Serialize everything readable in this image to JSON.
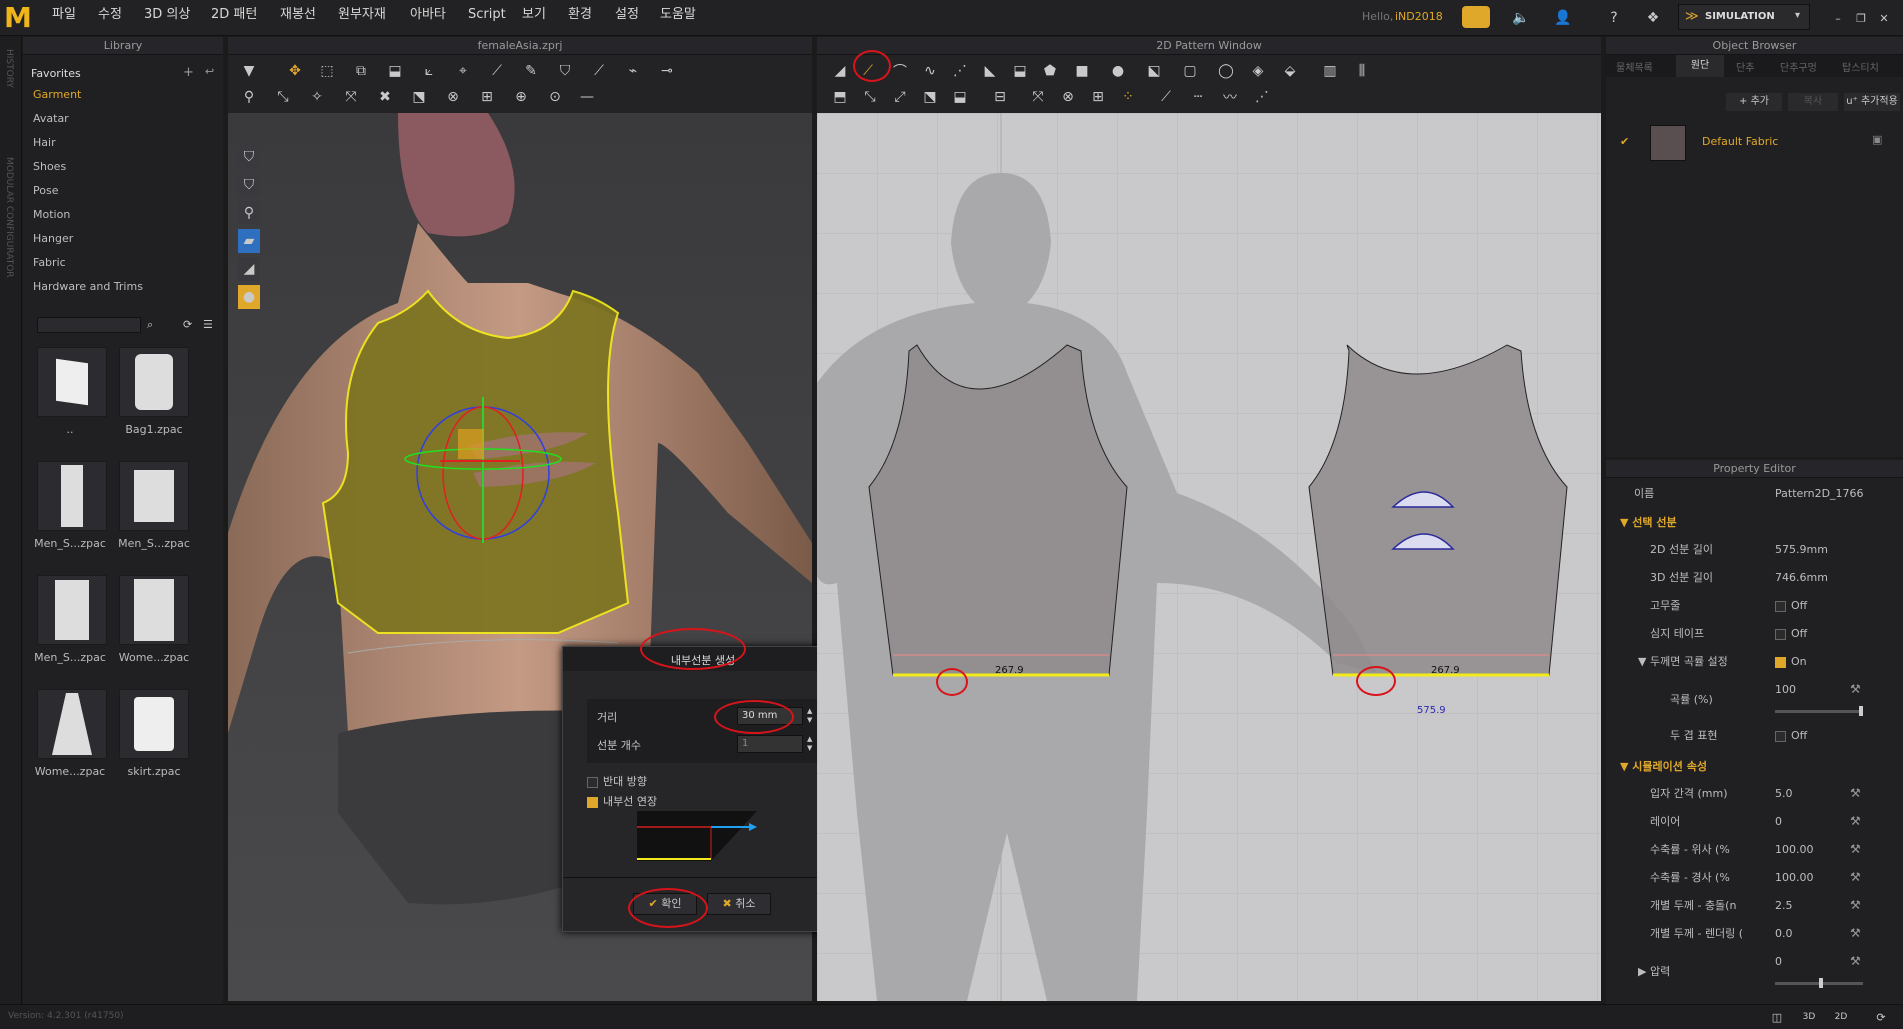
{
  "app": {
    "logo": "M",
    "greeting": "Hello,",
    "user": "iND2018",
    "simulation_label": "SIMULATION",
    "version": "Version: 4.2.301 (r41750)"
  },
  "menu": [
    "파일",
    "수정",
    "3D 의상",
    "2D 패턴",
    "재봉선",
    "원부자재",
    "아바타",
    "Script",
    "보기",
    "환경",
    "설정",
    "도움말"
  ],
  "left_strip": {
    "history": "HISTORY",
    "modular": "MODULAR CONFIGURATOR"
  },
  "library": {
    "title": "Library",
    "favorites": "Favorites",
    "items": [
      "Garment",
      "Avatar",
      "Hair",
      "Shoes",
      "Pose",
      "Motion",
      "Hanger",
      "Fabric",
      "Hardware and Trims"
    ],
    "search_placeholder": "",
    "thumbs": [
      {
        "label": ".."
      },
      {
        "label": "Bag1.zpac"
      },
      {
        "label": "Men_S...zpac"
      },
      {
        "label": "Men_S...zpac"
      },
      {
        "label": "Men_S...zpac"
      },
      {
        "label": "Wome...zpac"
      },
      {
        "label": "Wome...zpac"
      },
      {
        "label": "skirt.zpac"
      }
    ]
  },
  "window3d": {
    "title": "femaleAsia.zprj"
  },
  "window2d": {
    "title": "2D Pattern Window",
    "front_measure": "267.9",
    "back_measure": "267.9",
    "back_total": "575.9"
  },
  "dialog": {
    "title": "내부선분 생성",
    "distance_label": "거리",
    "distance_value": "30 mm",
    "count_label": "선분 개수",
    "count_value": "1",
    "reverse_label": "반대 방향",
    "extend_label": "내부선 연장",
    "ok_label": "확인",
    "cancel_label": "취소"
  },
  "object_browser": {
    "title": "Object Browser",
    "tabs": [
      "물체목록",
      "원단",
      "단추",
      "단추구멍",
      "탑스티치"
    ],
    "add_label": "+ 추가",
    "copy_label": "복사",
    "advanced_label": "u⁺ 추가적용",
    "fabric_name": "Default Fabric"
  },
  "property_editor": {
    "title": "Property Editor",
    "name_label": "이름",
    "name_value": "Pattern2D_1766",
    "section1": "선택 선분",
    "rows1": [
      {
        "label": "2D 선분 길이",
        "value": "575.9mm"
      },
      {
        "label": "3D 선분 길이",
        "value": "746.6mm"
      },
      {
        "label": "고무줄",
        "value": "Off"
      },
      {
        "label": "심지 테이프",
        "value": "Off"
      },
      {
        "label": "두께면 곡률 설정",
        "value": "On"
      },
      {
        "label": "곡률 (%)",
        "value": "100"
      },
      {
        "label": "두 겹 표현",
        "value": "Off"
      }
    ],
    "section2": "시뮬레이션 속성",
    "rows2": [
      {
        "label": "입자 간격 (mm)",
        "value": "5.0"
      },
      {
        "label": "레이어",
        "value": "0"
      },
      {
        "label": "수축률 - 위사 (%",
        "value": "100.00"
      },
      {
        "label": "수축률 - 경사 (%",
        "value": "100.00"
      },
      {
        "label": "개별 두께 - 충돌(n",
        "value": "2.5"
      },
      {
        "label": "개별 두께 - 렌더링 (",
        "value": "0.0"
      },
      {
        "label": "압력",
        "value": "0"
      }
    ]
  },
  "colors": {
    "accent": "#e0a82a",
    "bg": "#1b1b1c",
    "red": "#d8141a"
  }
}
